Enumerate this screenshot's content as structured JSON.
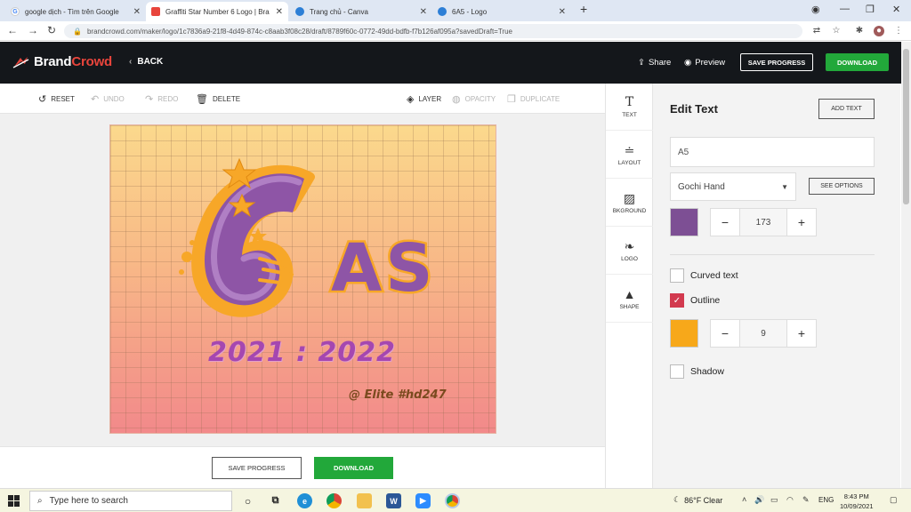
{
  "browser": {
    "tabs": [
      {
        "title": "google dịch - Tìm trên Google",
        "active": false,
        "favicon": "google-icon"
      },
      {
        "title": "Graffiti Star Number 6 Logo | Bra",
        "active": true,
        "favicon": "brandcrowd-icon"
      },
      {
        "title": "Trang chủ - Canva",
        "active": false,
        "favicon": "canva-icon"
      },
      {
        "title": "6A5 - Logo",
        "active": false,
        "favicon": "canva-icon"
      }
    ],
    "new_tab": "+",
    "url": "brandcrowd.com/maker/logo/1c7836a9-21f8-4d49-874c-c8aab3f08c28/draft/8789f60c-0772-49dd-bdfb-f7b126af095a?savedDraft=True"
  },
  "app": {
    "brand_first": "Brand",
    "brand_second": "Crowd",
    "back_label": "BACK",
    "share_label": "Share",
    "preview_label": "Preview",
    "save_progress_label": "SAVE PROGRESS",
    "download_label": "DOWNLOAD"
  },
  "toolbar": {
    "reset": "RESET",
    "undo": "UNDO",
    "redo": "REDO",
    "delete": "DELETE",
    "layer": "LAYER",
    "opacity": "OPACITY",
    "duplicate": "DUPLICATE"
  },
  "canvas": {
    "main_text": "AS",
    "year_text": "2021 : 2022",
    "signature_text": "@ Elite #hd247",
    "colors": {
      "purple": "#9b62b0",
      "orange": "#f7a728",
      "year": "#a547b0"
    }
  },
  "bottom": {
    "save_progress": "SAVE PROGRESS",
    "download": "DOWNLOAD"
  },
  "rail": [
    {
      "label": "TEXT",
      "icon": "text-icon"
    },
    {
      "label": "LAYOUT",
      "icon": "layout-icon"
    },
    {
      "label": "BKGROUND",
      "icon": "background-icon"
    },
    {
      "label": "LOGO",
      "icon": "logo-icon"
    },
    {
      "label": "SHAPE",
      "icon": "shape-icon"
    }
  ],
  "panel": {
    "title": "Edit Text",
    "add_text": "ADD TEXT",
    "text_value": "A5",
    "font": "Gochi Hand",
    "see_options": "SEE OPTIONS",
    "text_color": "#7d4f94",
    "font_size": "173",
    "curved_text_label": "Curved text",
    "curved_text_checked": false,
    "outline_label": "Outline",
    "outline_checked": true,
    "outline_color": "#f7a81a",
    "outline_size": "9",
    "shadow_label": "Shadow",
    "shadow_checked": false,
    "minus": "−",
    "plus": "+"
  },
  "taskbar": {
    "search_placeholder": "Type here to search",
    "weather": "86°F  Clear",
    "lang": "ENG",
    "time": "8:43 PM",
    "date": "10/09/2021"
  }
}
